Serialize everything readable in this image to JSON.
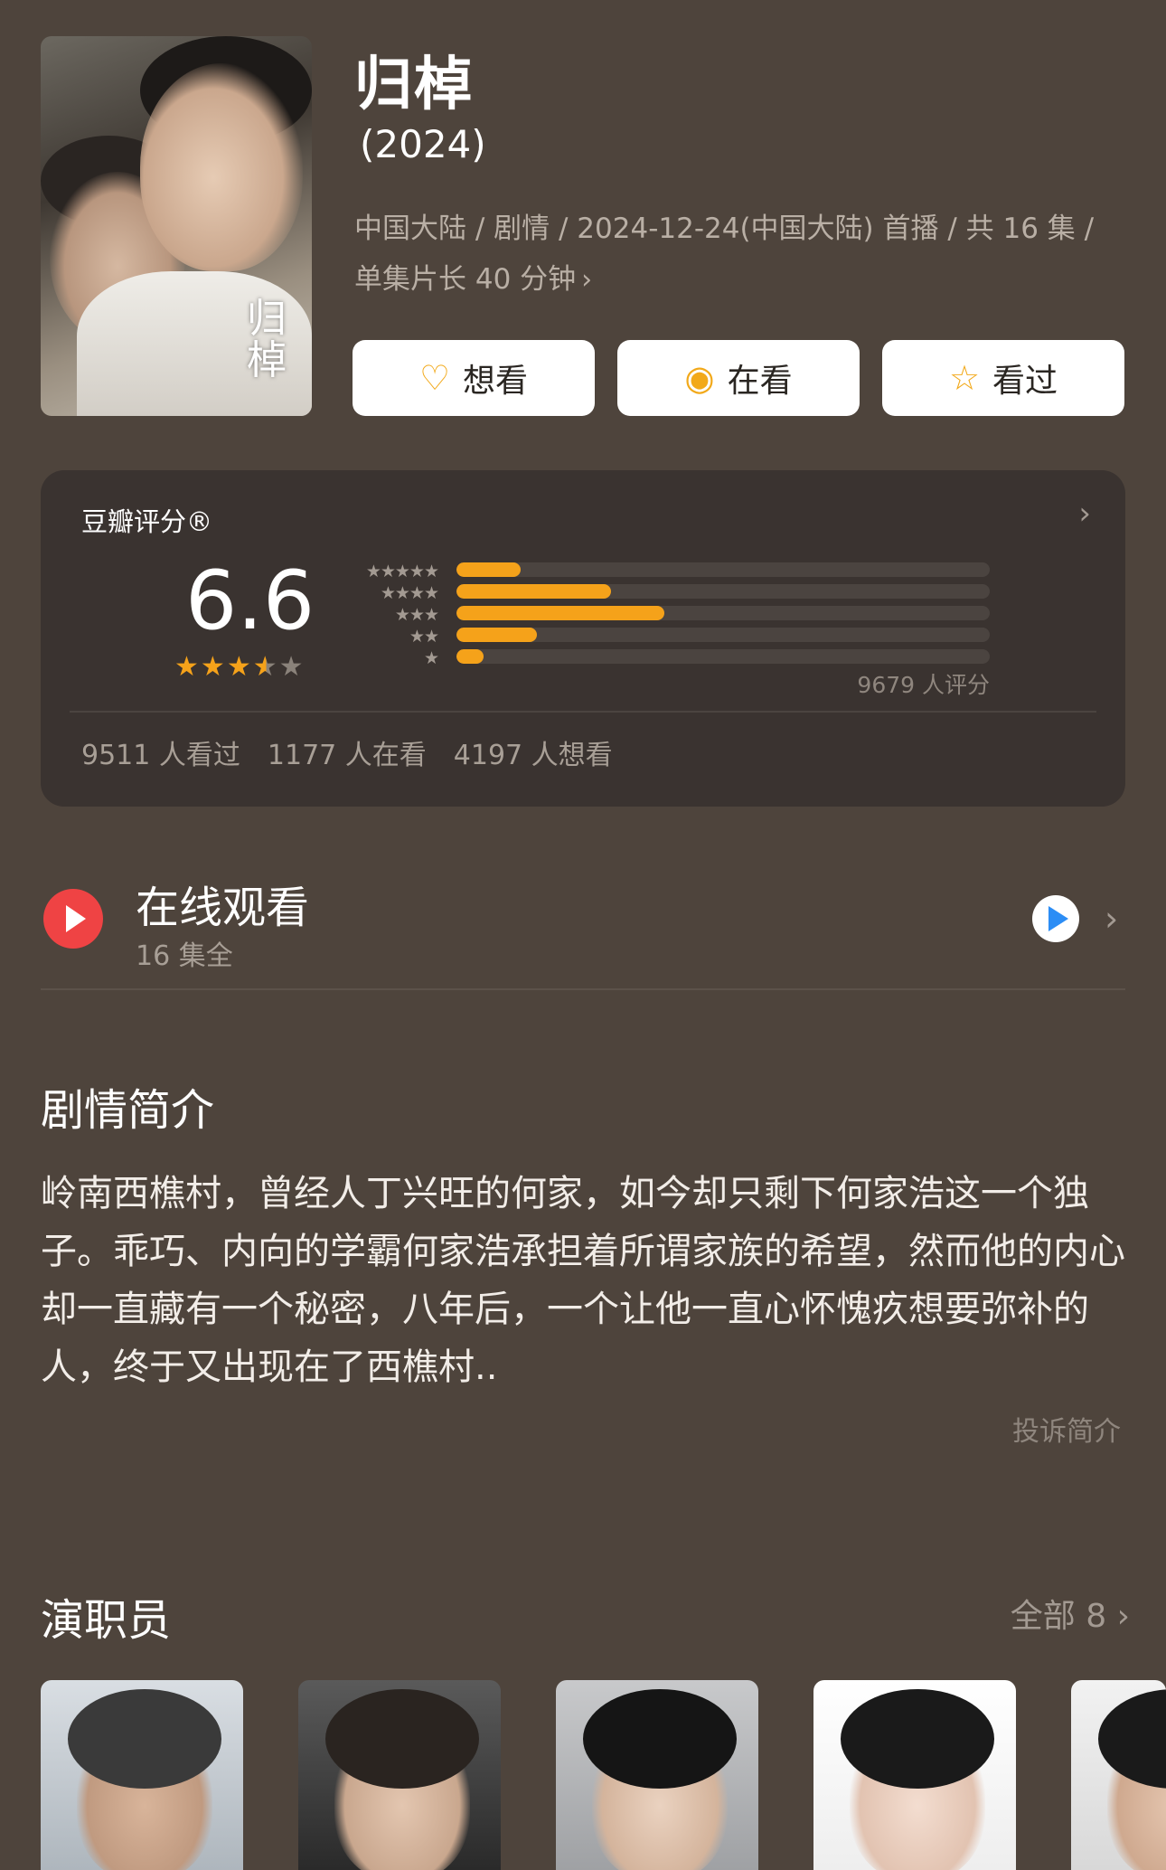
{
  "movie": {
    "title": "归棹",
    "year": "(2024)",
    "meta_line1": "中国大陆 / 剧情 / 2024-12-24(中国大陆) 首播 / 共 16 集 /",
    "meta_line2": "单集片长 40 分钟",
    "poster_text": "归棹"
  },
  "actions": [
    {
      "label": "想看",
      "icon": "heart-plus-icon"
    },
    {
      "label": "在看",
      "icon": "target-icon"
    },
    {
      "label": "看过",
      "icon": "star-outline-icon"
    }
  ],
  "rating": {
    "label": "豆瓣评分®",
    "score": "6.6",
    "stars_value": 3.5,
    "distribution_percent": [
      12,
      29,
      39,
      15,
      5
    ],
    "voters": "9679 人评分",
    "watched": "9511 人看过",
    "watching": "1177 人在看",
    "wish": "4197 人想看",
    "colors": {
      "accent": "#f5a21a"
    }
  },
  "watch_online": {
    "title": "在线观看",
    "subtitle": "16 集全"
  },
  "synopsis": {
    "title": "剧情简介",
    "text": "岭南西樵村，曾经人丁兴旺的何家，如今却只剩下何家浩这一个独子。乖巧、内向的学霸何家浩承担着所谓家族的希望，然而他的内心却一直藏有一个秘密，八年后，一个让他一直心怀愧疚想要弥补的人，终于又出现在了西樵村..",
    "report": "投诉简介"
  },
  "cast": {
    "title": "演职员",
    "all_label": "全部 8"
  }
}
